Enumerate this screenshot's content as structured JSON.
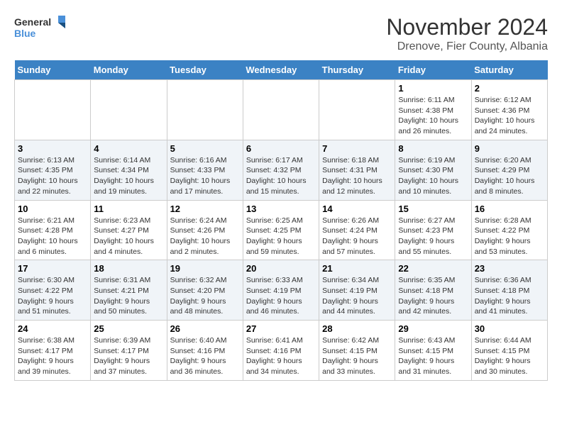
{
  "logo": {
    "line1": "General",
    "line2": "Blue"
  },
  "title": "November 2024",
  "subtitle": "Drenove, Fier County, Albania",
  "days_of_week": [
    "Sunday",
    "Monday",
    "Tuesday",
    "Wednesday",
    "Thursday",
    "Friday",
    "Saturday"
  ],
  "weeks": [
    [
      {
        "day": "",
        "content": ""
      },
      {
        "day": "",
        "content": ""
      },
      {
        "day": "",
        "content": ""
      },
      {
        "day": "",
        "content": ""
      },
      {
        "day": "",
        "content": ""
      },
      {
        "day": "1",
        "content": "Sunrise: 6:11 AM\nSunset: 4:38 PM\nDaylight: 10 hours and 26 minutes."
      },
      {
        "day": "2",
        "content": "Sunrise: 6:12 AM\nSunset: 4:36 PM\nDaylight: 10 hours and 24 minutes."
      }
    ],
    [
      {
        "day": "3",
        "content": "Sunrise: 6:13 AM\nSunset: 4:35 PM\nDaylight: 10 hours and 22 minutes."
      },
      {
        "day": "4",
        "content": "Sunrise: 6:14 AM\nSunset: 4:34 PM\nDaylight: 10 hours and 19 minutes."
      },
      {
        "day": "5",
        "content": "Sunrise: 6:16 AM\nSunset: 4:33 PM\nDaylight: 10 hours and 17 minutes."
      },
      {
        "day": "6",
        "content": "Sunrise: 6:17 AM\nSunset: 4:32 PM\nDaylight: 10 hours and 15 minutes."
      },
      {
        "day": "7",
        "content": "Sunrise: 6:18 AM\nSunset: 4:31 PM\nDaylight: 10 hours and 12 minutes."
      },
      {
        "day": "8",
        "content": "Sunrise: 6:19 AM\nSunset: 4:30 PM\nDaylight: 10 hours and 10 minutes."
      },
      {
        "day": "9",
        "content": "Sunrise: 6:20 AM\nSunset: 4:29 PM\nDaylight: 10 hours and 8 minutes."
      }
    ],
    [
      {
        "day": "10",
        "content": "Sunrise: 6:21 AM\nSunset: 4:28 PM\nDaylight: 10 hours and 6 minutes."
      },
      {
        "day": "11",
        "content": "Sunrise: 6:23 AM\nSunset: 4:27 PM\nDaylight: 10 hours and 4 minutes."
      },
      {
        "day": "12",
        "content": "Sunrise: 6:24 AM\nSunset: 4:26 PM\nDaylight: 10 hours and 2 minutes."
      },
      {
        "day": "13",
        "content": "Sunrise: 6:25 AM\nSunset: 4:25 PM\nDaylight: 9 hours and 59 minutes."
      },
      {
        "day": "14",
        "content": "Sunrise: 6:26 AM\nSunset: 4:24 PM\nDaylight: 9 hours and 57 minutes."
      },
      {
        "day": "15",
        "content": "Sunrise: 6:27 AM\nSunset: 4:23 PM\nDaylight: 9 hours and 55 minutes."
      },
      {
        "day": "16",
        "content": "Sunrise: 6:28 AM\nSunset: 4:22 PM\nDaylight: 9 hours and 53 minutes."
      }
    ],
    [
      {
        "day": "17",
        "content": "Sunrise: 6:30 AM\nSunset: 4:22 PM\nDaylight: 9 hours and 51 minutes."
      },
      {
        "day": "18",
        "content": "Sunrise: 6:31 AM\nSunset: 4:21 PM\nDaylight: 9 hours and 50 minutes."
      },
      {
        "day": "19",
        "content": "Sunrise: 6:32 AM\nSunset: 4:20 PM\nDaylight: 9 hours and 48 minutes."
      },
      {
        "day": "20",
        "content": "Sunrise: 6:33 AM\nSunset: 4:19 PM\nDaylight: 9 hours and 46 minutes."
      },
      {
        "day": "21",
        "content": "Sunrise: 6:34 AM\nSunset: 4:19 PM\nDaylight: 9 hours and 44 minutes."
      },
      {
        "day": "22",
        "content": "Sunrise: 6:35 AM\nSunset: 4:18 PM\nDaylight: 9 hours and 42 minutes."
      },
      {
        "day": "23",
        "content": "Sunrise: 6:36 AM\nSunset: 4:18 PM\nDaylight: 9 hours and 41 minutes."
      }
    ],
    [
      {
        "day": "24",
        "content": "Sunrise: 6:38 AM\nSunset: 4:17 PM\nDaylight: 9 hours and 39 minutes."
      },
      {
        "day": "25",
        "content": "Sunrise: 6:39 AM\nSunset: 4:17 PM\nDaylight: 9 hours and 37 minutes."
      },
      {
        "day": "26",
        "content": "Sunrise: 6:40 AM\nSunset: 4:16 PM\nDaylight: 9 hours and 36 minutes."
      },
      {
        "day": "27",
        "content": "Sunrise: 6:41 AM\nSunset: 4:16 PM\nDaylight: 9 hours and 34 minutes."
      },
      {
        "day": "28",
        "content": "Sunrise: 6:42 AM\nSunset: 4:15 PM\nDaylight: 9 hours and 33 minutes."
      },
      {
        "day": "29",
        "content": "Sunrise: 6:43 AM\nSunset: 4:15 PM\nDaylight: 9 hours and 31 minutes."
      },
      {
        "day": "30",
        "content": "Sunrise: 6:44 AM\nSunset: 4:15 PM\nDaylight: 9 hours and 30 minutes."
      }
    ]
  ]
}
